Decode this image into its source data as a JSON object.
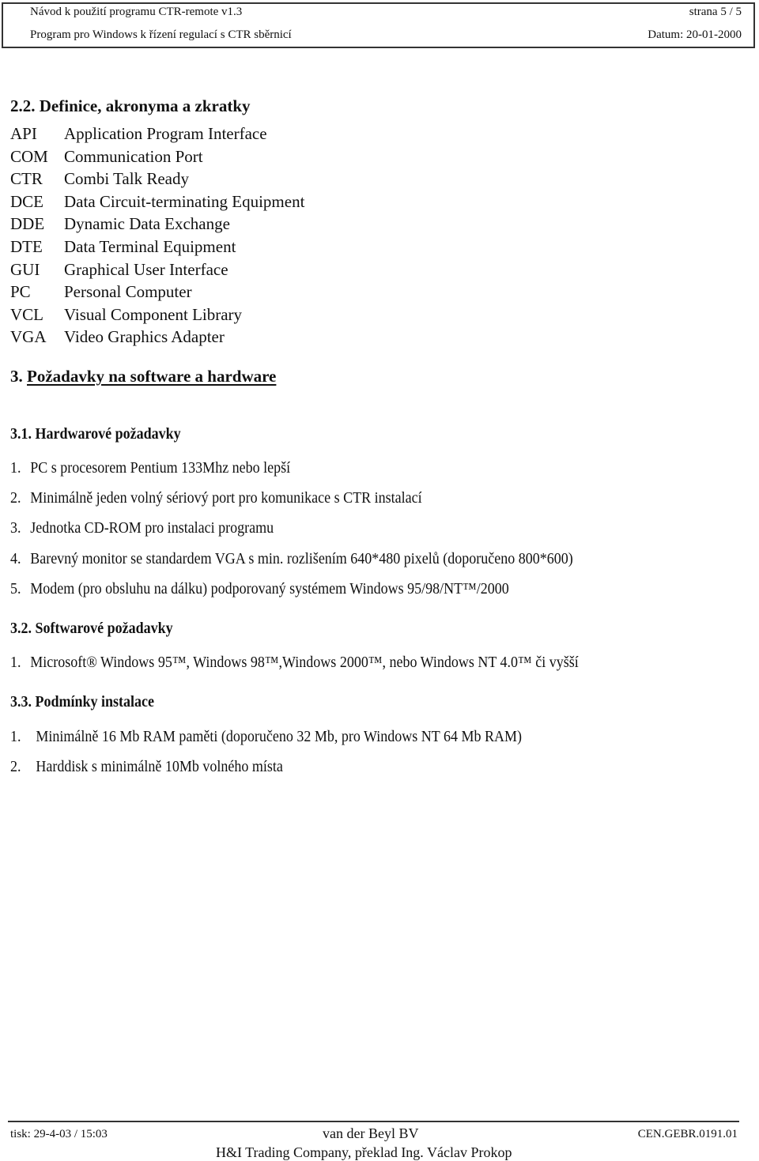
{
  "header": {
    "title": "Návod k použití programu CTR-remote v1.3",
    "subtitle": "Program pro Windows k řízení regulací s CTR sběrnicí",
    "page": "strana  5 / 5",
    "date": "Datum:  20-01-2000"
  },
  "section_2_2": {
    "heading": "2.2. Definice, akronyma a zkratky",
    "acronyms": [
      {
        "abbr": "API",
        "definition": "Application Program Interface"
      },
      {
        "abbr": "COM",
        "definition": "Communication Port"
      },
      {
        "abbr": "CTR",
        "definition": "Combi Talk Ready"
      },
      {
        "abbr": "DCE",
        "definition": "Data Circuit-terminating Equipment"
      },
      {
        "abbr": "DDE",
        "definition": "Dynamic Data Exchange"
      },
      {
        "abbr": "DTE",
        "definition": "Data Terminal Equipment"
      },
      {
        "abbr": "GUI",
        "definition": "Graphical User Interface"
      },
      {
        "abbr": "PC",
        "definition": "Personal Computer"
      },
      {
        "abbr": "VCL",
        "definition": "Visual Component Library"
      },
      {
        "abbr": "VGA",
        "definition": "Video Graphics Adapter"
      }
    ]
  },
  "section_3": {
    "number": "3.",
    "heading": "Požadavky na software a hardware"
  },
  "section_3_1": {
    "heading": "3.1. Hardwarové požadavky",
    "items": [
      {
        "num": "1.",
        "text": "PC s procesorem Pentium 133Mhz nebo lepší"
      },
      {
        "num": "2.",
        "text": "Minimálně jeden volný sériový port pro komunikace s CTR instalací"
      },
      {
        "num": "3.",
        "text": "Jednotka CD-ROM pro instalaci programu"
      },
      {
        "num": "4.",
        "text": "Barevný monitor se standardem VGA  s min. rozlišením 640*480 pixelů (doporučeno 800*600)"
      },
      {
        "num": "5.",
        "text": "Modem (pro obsluhu na dálku) podporovaný systémem Windows 95/98/NT™/2000"
      }
    ]
  },
  "section_3_2": {
    "heading": "3.2. Softwarové požadavky",
    "items": [
      {
        "num": "1.",
        "text": "Microsoft® Windows 95™, Windows 98™,Windows 2000™, nebo Windows NT 4.0™ či vyšší"
      }
    ]
  },
  "section_3_3": {
    "heading": "3.3. Podmínky instalace",
    "items": [
      {
        "num": "1.",
        "text": "Minimálně 16 Mb RAM paměti (doporučeno 32 Mb, pro Windows NT 64 Mb RAM)"
      },
      {
        "num": "2.",
        "text": "Harddisk s minimálně 10Mb volného místa"
      }
    ]
  },
  "footer": {
    "print": "tisk: 29-4-03 / 15:03",
    "company": "van der Beyl BV",
    "code": "CEN.GEBR.0191.01",
    "translator": "H&I Trading Company, překlad Ing. Václav Prokop"
  }
}
